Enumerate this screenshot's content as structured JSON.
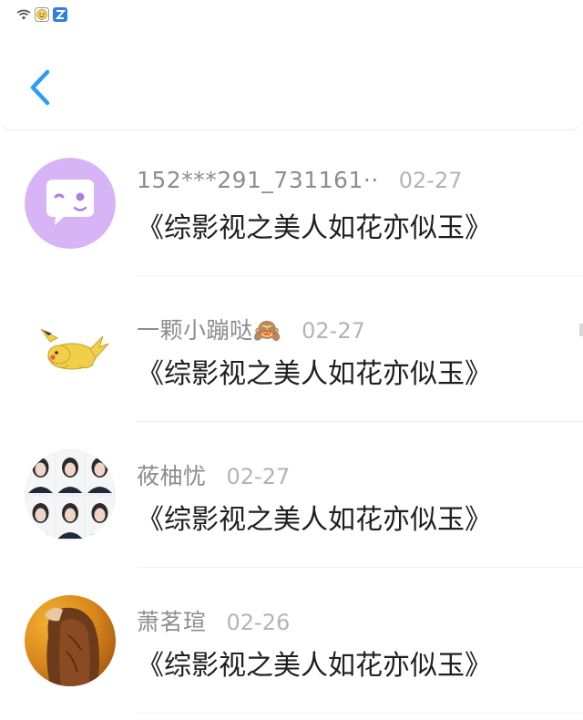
{
  "status_bar": {
    "icons": [
      "wifi-icon",
      "emoji-app-icon",
      "app-badge-icon"
    ]
  },
  "nav": {
    "back_icon": "chevron-left-icon",
    "accent_color": "#2a9df4"
  },
  "messages": [
    {
      "name": "152***291_731161··",
      "date": "02-27",
      "title": "《综影视之美人如花亦似玉》",
      "avatar": "chat-bubble-avatar"
    },
    {
      "name": "一颗小蹦哒🙈",
      "date": "02-27",
      "title": "《综影视之美人如花亦似玉》",
      "avatar": "pikachu-avatar"
    },
    {
      "name": "莜柚忧",
      "date": "02-27",
      "title": "《综影视之美人如花亦似玉》",
      "avatar": "photo-grid-avatar"
    },
    {
      "name": "萧茗瑄",
      "date": "02-26",
      "title": "《综影视之美人如花亦似玉》",
      "avatar": "portrait-photo-avatar"
    }
  ]
}
